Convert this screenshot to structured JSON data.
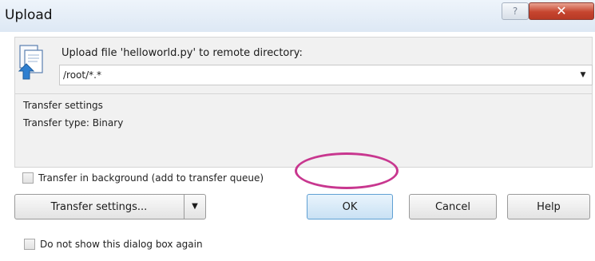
{
  "window": {
    "title": "Upload",
    "help_symbol": "?",
    "close_symbol": "✕"
  },
  "upload": {
    "prompt": "Upload file 'helloworld.py' to remote directory:",
    "directory_value": "/root/*.*",
    "dropdown_arrow": "▼"
  },
  "settings": {
    "heading": "Transfer settings",
    "type_line": "Transfer type: Binary"
  },
  "options": {
    "background_label": "Transfer in background (add to transfer queue)",
    "background_checked": false,
    "do_not_show_label": "Do not show this dialog box again",
    "do_not_show_checked": false
  },
  "buttons": {
    "transfer_settings": "Transfer settings...",
    "transfer_settings_arrow": "▼",
    "ok": "OK",
    "cancel": "Cancel",
    "help": "Help"
  },
  "colors": {
    "highlight": "#c8378f",
    "close_button": "#c6452f",
    "titlebar": "#dde8f4"
  },
  "icons": {
    "upload": "upload-file-icon"
  }
}
